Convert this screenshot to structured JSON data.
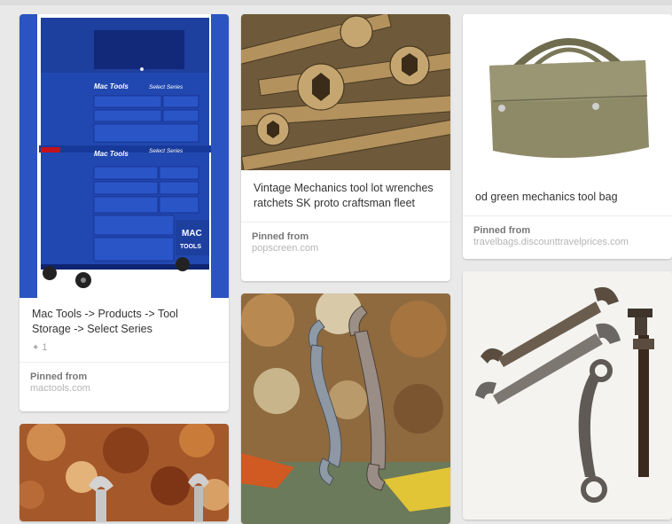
{
  "pins": [
    {
      "image_alt": "blue mac tools tool storage cabinet",
      "description": "Mac Tools -> Products -> Tool Storage -> Select Series",
      "repin_count": "1",
      "pinned_label": "Pinned from",
      "source": "mactools.com",
      "logo_top": "MAC",
      "logo_bottom": "TOOLS",
      "brand_label": "Mac Tools",
      "series_label": "Select Series"
    },
    {
      "image_alt": "rusty wrenches",
      "description": "",
      "pinned_label": "",
      "source": ""
    },
    {
      "image_alt": "vintage brass wrenches pile",
      "description": "Vintage Mechanics tool lot wrenches ratchets SK proto craftsman fleet",
      "pinned_label": "Pinned from",
      "source": "popscreen.com"
    },
    {
      "image_alt": "two rusty s-wrenches on rusted metal",
      "description": "",
      "pinned_label": "",
      "source": ""
    },
    {
      "image_alt": "olive green canvas mechanics tool bag",
      "description": "od green mechanics tool bag",
      "pinned_label": "Pinned from",
      "source": "travelbags.discounttravelprices.com"
    },
    {
      "image_alt": "antique wrenches on white background",
      "description": "",
      "pinned_label": "",
      "source": ""
    }
  ],
  "colors": {
    "background": "#e9e9e9",
    "cabinet_blue": "#1f49b8",
    "source_label": "#777777",
    "source_domain": "#b5b5b5"
  },
  "icons": {
    "repin": "pushpin-icon"
  }
}
